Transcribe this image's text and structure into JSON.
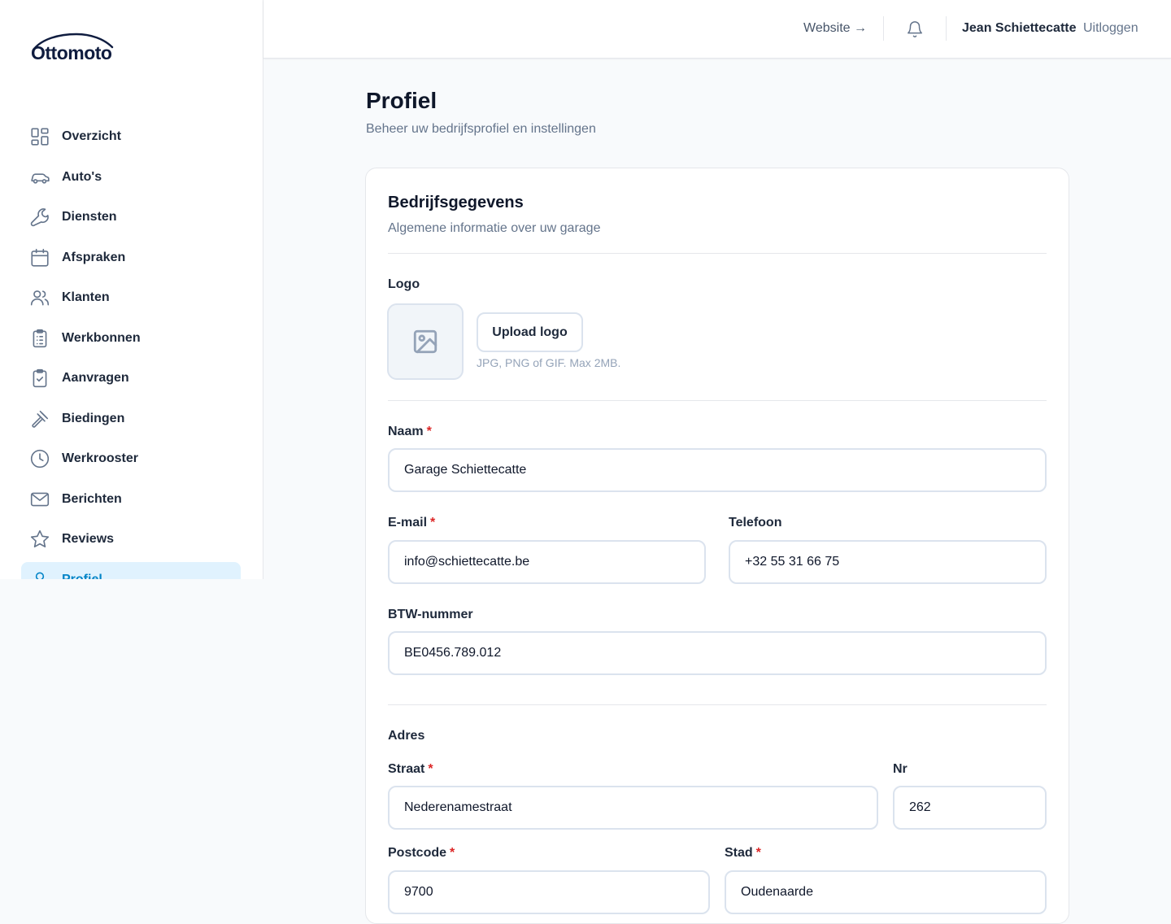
{
  "brand": {
    "name": "Ottomoto"
  },
  "sidebar": {
    "items": [
      {
        "label": "Overzicht",
        "icon": "grid-icon"
      },
      {
        "label": "Auto's",
        "icon": "car-icon"
      },
      {
        "label": "Diensten",
        "icon": "wrench-icon"
      },
      {
        "label": "Afspraken",
        "icon": "calendar-icon"
      },
      {
        "label": "Klanten",
        "icon": "users-icon"
      },
      {
        "label": "Werkbonnen",
        "icon": "clipboard-list-icon"
      },
      {
        "label": "Aanvragen",
        "icon": "clipboard-check-icon"
      },
      {
        "label": "Biedingen",
        "icon": "gavel-icon"
      },
      {
        "label": "Werkrooster",
        "icon": "clock-icon"
      },
      {
        "label": "Berichten",
        "icon": "mail-icon"
      },
      {
        "label": "Reviews",
        "icon": "star-icon"
      },
      {
        "label": "Profiel",
        "icon": "user-icon"
      }
    ]
  },
  "topbar": {
    "website": "Website →",
    "user_name": "Jean Schiettecatte",
    "logout": "Uitloggen"
  },
  "page": {
    "title": "Profiel",
    "subtitle": "Beheer uw bedrijfsprofiel en instellingen"
  },
  "company": {
    "title": "Bedrijfsgegevens",
    "subtitle": "Algemene informatie over uw garage",
    "logo_label": "Logo",
    "upload_button": "Upload logo",
    "upload_hint": "JPG, PNG of GIF. Max 2MB.",
    "name_label": "Naam",
    "name_value": "Garage Schiettecatte",
    "email_label": "E-mail",
    "email_value": "info@schiettecatte.be",
    "phone_label": "Telefoon",
    "phone_value": "+32 55 31 66 75",
    "vat_label": "BTW-nummer",
    "vat_value": "BE0456.789.012",
    "address_heading": "Adres",
    "street_label": "Straat",
    "street_value": "Nederenamestraat",
    "nr_label": "Nr",
    "nr_value": "262",
    "postcode_label": "Postcode",
    "postcode_value": "9700",
    "city_label": "Stad",
    "city_value": "Oudenaarde",
    "required_mark": "*"
  },
  "colors": {
    "accent": "#0284c7",
    "active_bg": "#e0f2fe",
    "required": "#dc2626"
  }
}
